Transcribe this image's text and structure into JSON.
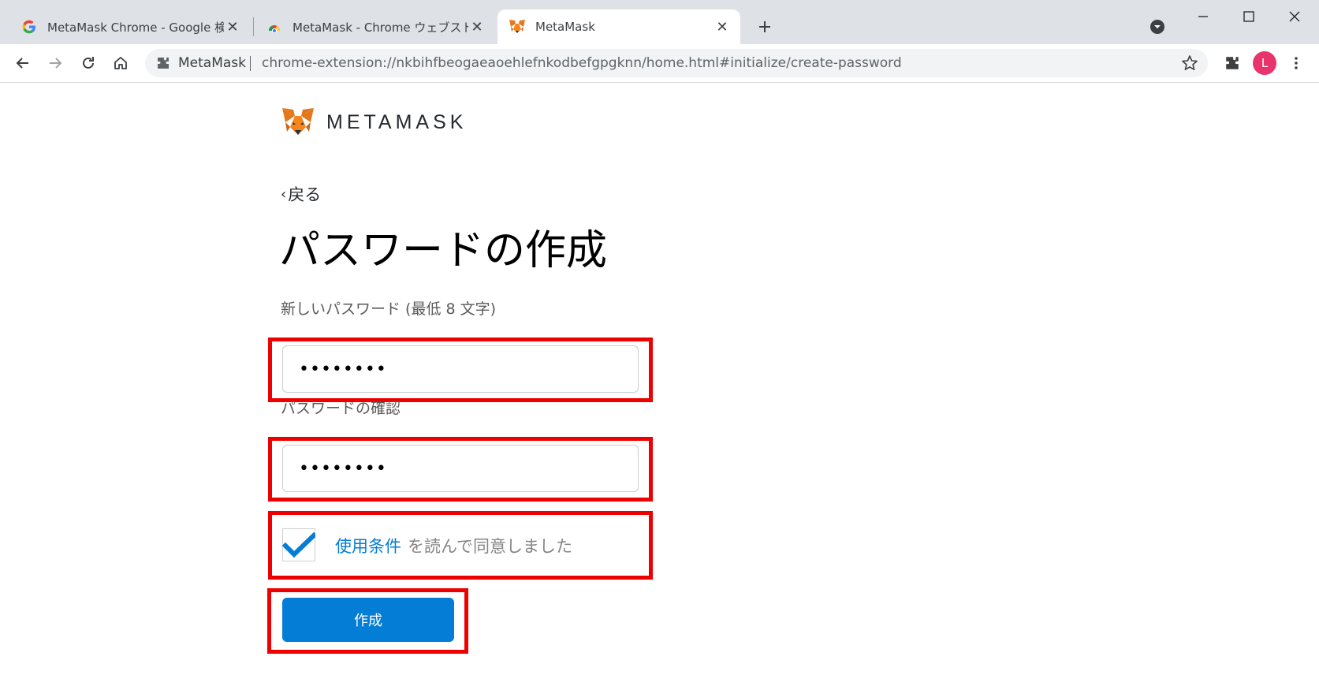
{
  "browser": {
    "tabs": [
      {
        "title": "MetaMask Chrome - Google 検索",
        "favicon": "google-icon",
        "active": false
      },
      {
        "title": "MetaMask - Chrome ウェブストア",
        "favicon": "chrome-webstore-icon",
        "active": false
      },
      {
        "title": "MetaMask",
        "favicon": "metamask-fox-icon",
        "active": true
      }
    ],
    "omnibox": {
      "site_label": "MetaMask",
      "url": "chrome-extension://nkbihfbeogaeaoehlefnkodbefgpgknn/home.html#initialize/create-password"
    },
    "profile_initial": "L"
  },
  "page": {
    "brand": "METAMASK",
    "back_label": "戻る",
    "title": "パスワードの作成",
    "new_password_label": "新しいパスワード (最低 8 文字)",
    "new_password_value": "password",
    "confirm_password_label": "パスワードの確認",
    "confirm_password_value": "password",
    "terms_link": "使用条件",
    "terms_rest": "を読んで同意しました",
    "terms_checked": true,
    "create_button": "作成"
  },
  "colors": {
    "accent_blue": "#037dd6",
    "highlight_red": "#ef0000",
    "tabstrip": "#dee1e6"
  }
}
